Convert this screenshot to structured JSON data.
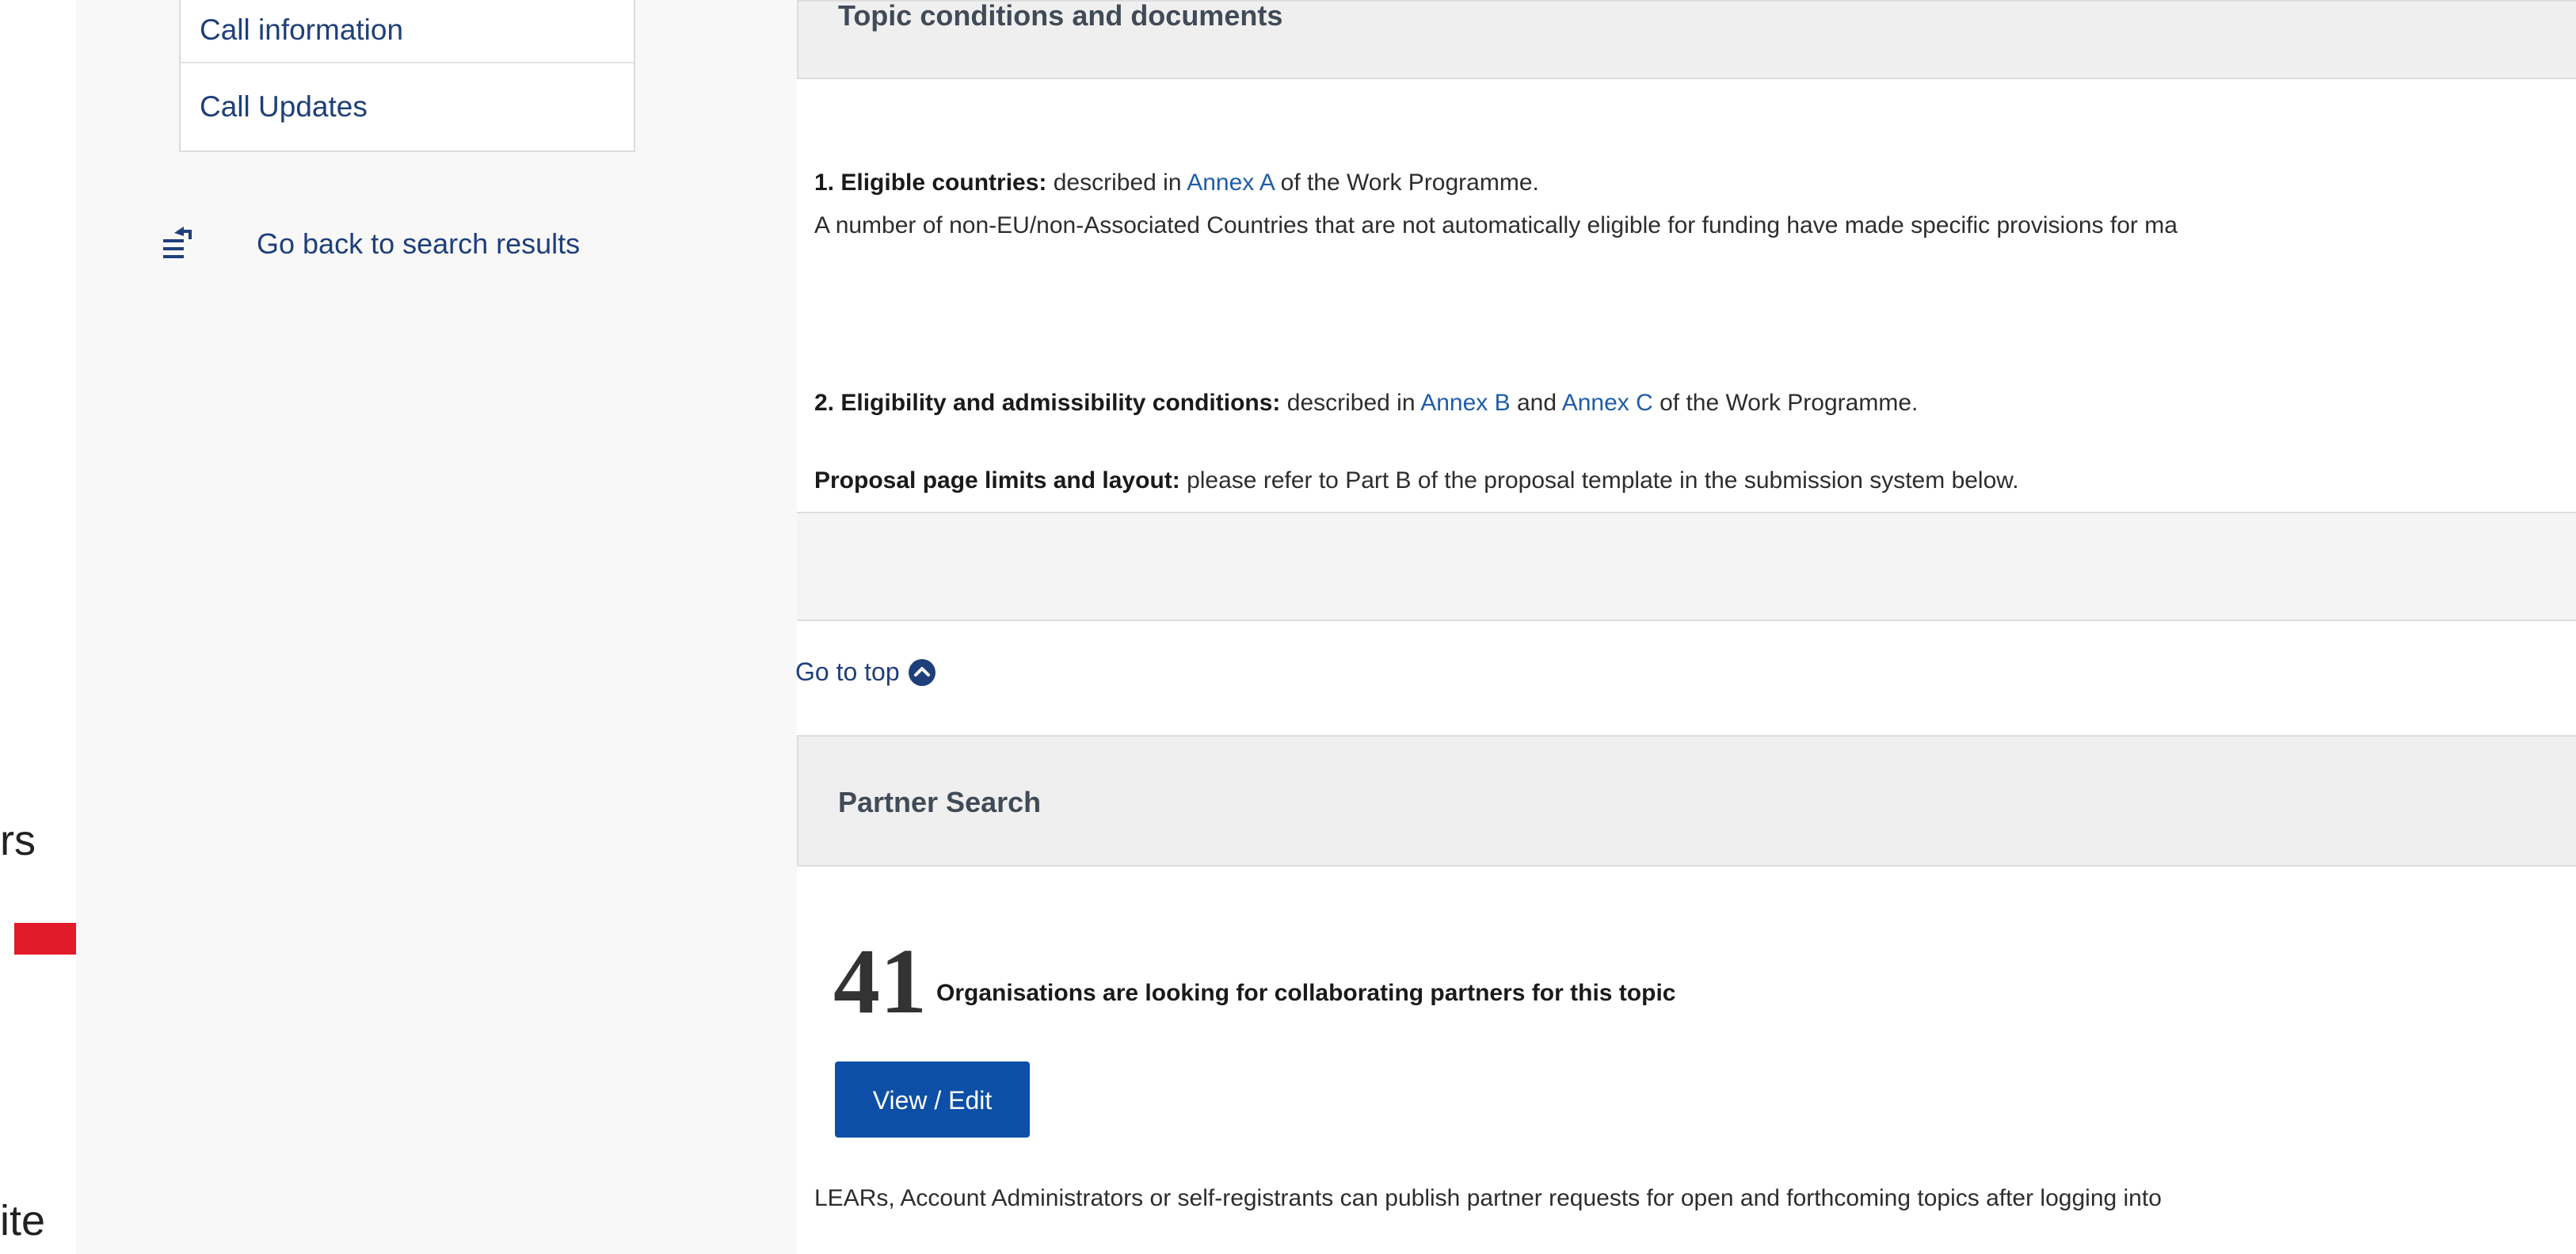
{
  "slide": {
    "fragment_1": "rs",
    "fragment_2": "ite",
    "arrow_color": "#e11b2a"
  },
  "sidebar": {
    "items": [
      {
        "label": "Call information"
      },
      {
        "label": "Call Updates"
      }
    ],
    "back_link": "Go back to search results",
    "back_icon": "back-list-icon"
  },
  "topic": {
    "header": "Topic conditions and documents",
    "line1_label": "1. Eligible countries:",
    "line1_pre": " described in ",
    "line1_link": "Annex A",
    "line1_post": " of the Work Programme.",
    "line2": "A number of non-EU/non-Associated Countries that are not automatically eligible for funding have made specific provisions for ma",
    "line3_label": "2. Eligibility and admissibility conditions:",
    "line3_pre": " described in ",
    "line3_link1": "Annex B",
    "line3_mid": " and ",
    "line3_link2": "Annex C",
    "line3_post": " of the Work Programme.",
    "line4_label": "Proposal page limits and layout:",
    "line4_text": " please refer to Part B of the proposal template in the submission system below."
  },
  "go_top": {
    "label": "Go to top",
    "icon": "chevron-up-circle-icon"
  },
  "partner": {
    "header": "Partner Search",
    "count": "41",
    "count_text": "Organisations are looking for collaborating partners for this topic",
    "button": "View / Edit",
    "footer": "LEARs, Account Administrators or self-registrants can publish partner requests for open and forthcoming topics after logging into"
  },
  "colors": {
    "accent": "#0d4fa6",
    "link": "#1f5da8",
    "nav_text": "#1f3f7a"
  }
}
